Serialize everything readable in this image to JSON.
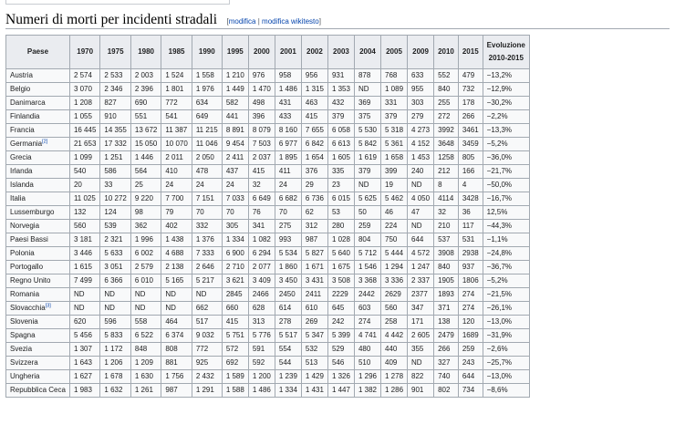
{
  "heading": {
    "title": "Numeri di morti per incidenti stradali",
    "edit_open": "[",
    "edit_link": "modifica",
    "edit_sep": " | ",
    "edit_wiki_link": "modifica wikitesto",
    "edit_close": "]"
  },
  "table": {
    "headers": {
      "country": "Paese",
      "years": [
        "1970",
        "1975",
        "1980",
        "1985",
        "1990",
        "1995",
        "2000",
        "2001",
        "2002",
        "2003",
        "2004",
        "2005",
        "2009",
        "2010",
        "2015"
      ],
      "evolution_line1": "Evoluzione",
      "evolution_line2": "2010-2015"
    },
    "rows": [
      {
        "country": "Austria",
        "ref": "",
        "values": [
          "2 574",
          "2 533",
          "2 003",
          "1 524",
          "1 558",
          "1 210",
          "976",
          "958",
          "956",
          "931",
          "878",
          "768",
          "633",
          "552",
          "479"
        ],
        "change": "−13,2%"
      },
      {
        "country": "Belgio",
        "ref": "",
        "values": [
          "3 070",
          "2 346",
          "2 396",
          "1 801",
          "1 976",
          "1 449",
          "1 470",
          "1 486",
          "1 315",
          "1 353",
          "ND",
          "1 089",
          "955",
          "840",
          "732"
        ],
        "change": "−12,9%"
      },
      {
        "country": "Danimarca",
        "ref": "",
        "values": [
          "1 208",
          "827",
          "690",
          "772",
          "634",
          "582",
          "498",
          "431",
          "463",
          "432",
          "369",
          "331",
          "303",
          "255",
          "178"
        ],
        "change": "−30,2%"
      },
      {
        "country": "Finlandia",
        "ref": "",
        "values": [
          "1 055",
          "910",
          "551",
          "541",
          "649",
          "441",
          "396",
          "433",
          "415",
          "379",
          "375",
          "379",
          "279",
          "272",
          "266"
        ],
        "change": "−2,2%"
      },
      {
        "country": "Francia",
        "ref": "",
        "values": [
          "16 445",
          "14 355",
          "13 672",
          "11 387",
          "11 215",
          "8 891",
          "8 079",
          "8 160",
          "7 655",
          "6 058",
          "5 530",
          "5 318",
          "4 273",
          "3992",
          "3461"
        ],
        "change": "−13,3%"
      },
      {
        "country": "Germania",
        "ref": "[2]",
        "values": [
          "21 653",
          "17 332",
          "15 050",
          "10 070",
          "11 046",
          "9 454",
          "7 503",
          "6 977",
          "6 842",
          "6 613",
          "5 842",
          "5 361",
          "4 152",
          "3648",
          "3459"
        ],
        "change": "−5,2%"
      },
      {
        "country": "Grecia",
        "ref": "",
        "values": [
          "1 099",
          "1 251",
          "1 446",
          "2 011",
          "2 050",
          "2 411",
          "2 037",
          "1 895",
          "1 654",
          "1 605",
          "1 619",
          "1 658",
          "1 453",
          "1258",
          "805"
        ],
        "change": "−36,0%"
      },
      {
        "country": "Irlanda",
        "ref": "",
        "values": [
          "540",
          "586",
          "564",
          "410",
          "478",
          "437",
          "415",
          "411",
          "376",
          "335",
          "379",
          "399",
          "240",
          "212",
          "166"
        ],
        "change": "−21,7%"
      },
      {
        "country": "Islanda",
        "ref": "",
        "values": [
          "20",
          "33",
          "25",
          "24",
          "24",
          "24",
          "32",
          "24",
          "29",
          "23",
          "ND",
          "19",
          "ND",
          "8",
          "4"
        ],
        "change": "−50,0%"
      },
      {
        "country": "Italia",
        "ref": "",
        "values": [
          "11 025",
          "10 272",
          "9 220",
          "7 700",
          "7 151",
          "7 033",
          "6 649",
          "6 682",
          "6 736",
          "6 015",
          "5 625",
          "5 462",
          "4 050",
          "4114",
          "3428"
        ],
        "change": "−16,7%"
      },
      {
        "country": "Lussemburgo",
        "ref": "",
        "values": [
          "132",
          "124",
          "98",
          "79",
          "70",
          "70",
          "76",
          "70",
          "62",
          "53",
          "50",
          "46",
          "47",
          "32",
          "36"
        ],
        "change": "12,5%"
      },
      {
        "country": "Norvegia",
        "ref": "",
        "values": [
          "560",
          "539",
          "362",
          "402",
          "332",
          "305",
          "341",
          "275",
          "312",
          "280",
          "259",
          "224",
          "ND",
          "210",
          "117"
        ],
        "change": "−44,3%"
      },
      {
        "country": "Paesi Bassi",
        "ref": "",
        "values": [
          "3 181",
          "2 321",
          "1 996",
          "1 438",
          "1 376",
          "1 334",
          "1 082",
          "993",
          "987",
          "1 028",
          "804",
          "750",
          "644",
          "537",
          "531"
        ],
        "change": "−1,1%"
      },
      {
        "country": "Polonia",
        "ref": "",
        "values": [
          "3 446",
          "5 633",
          "6 002",
          "4 688",
          "7 333",
          "6 900",
          "6 294",
          "5 534",
          "5 827",
          "5 640",
          "5 712",
          "5 444",
          "4 572",
          "3908",
          "2938"
        ],
        "change": "−24,8%"
      },
      {
        "country": "Portogallo",
        "ref": "",
        "values": [
          "1 615",
          "3 051",
          "2 579",
          "2 138",
          "2 646",
          "2 710",
          "2 077",
          "1 860",
          "1 671",
          "1 675",
          "1 546",
          "1 294",
          "1 247",
          "840",
          "937"
        ],
        "change": "−36,7%"
      },
      {
        "country": "Regno Unito",
        "ref": "",
        "values": [
          "7 499",
          "6 366",
          "6 010",
          "5 165",
          "5 217",
          "3 621",
          "3 409",
          "3 450",
          "3 431",
          "3 508",
          "3 368",
          "3 336",
          "2 337",
          "1905",
          "1806"
        ],
        "change": "−5,2%"
      },
      {
        "country": "Romania",
        "ref": "",
        "values": [
          "ND",
          "ND",
          "ND",
          "ND",
          "ND",
          "2845",
          "2466",
          "2450",
          "2411",
          "2229",
          "2442",
          "2629",
          "2377",
          "1893",
          "274"
        ],
        "change": "−21,5%"
      },
      {
        "country": "Slovacchia",
        "ref": "[3]",
        "values": [
          "ND",
          "ND",
          "ND",
          "ND",
          "662",
          "660",
          "628",
          "614",
          "610",
          "645",
          "603",
          "560",
          "347",
          "371",
          "274"
        ],
        "change": "−26,1%"
      },
      {
        "country": "Slovenia",
        "ref": "",
        "values": [
          "620",
          "596",
          "558",
          "464",
          "517",
          "415",
          "313",
          "278",
          "269",
          "242",
          "274",
          "258",
          "171",
          "138",
          "120"
        ],
        "change": "−13,0%"
      },
      {
        "country": "Spagna",
        "ref": "",
        "values": [
          "5 456",
          "5 833",
          "6 522",
          "6 374",
          "9 032",
          "5 751",
          "5 776",
          "5 517",
          "5 347",
          "5 399",
          "4 741",
          "4 442",
          "2 605",
          "2479",
          "1689"
        ],
        "change": "−31,9%"
      },
      {
        "country": "Svezia",
        "ref": "",
        "values": [
          "1 307",
          "1 172",
          "848",
          "808",
          "772",
          "572",
          "591",
          "554",
          "532",
          "529",
          "480",
          "440",
          "355",
          "266",
          "259"
        ],
        "change": "−2,6%"
      },
      {
        "country": "Svizzera",
        "ref": "",
        "values": [
          "1 643",
          "1 206",
          "1 209",
          "881",
          "925",
          "692",
          "592",
          "544",
          "513",
          "546",
          "510",
          "409",
          "ND",
          "327",
          "243"
        ],
        "change": "−25,7%"
      },
      {
        "country": "Ungheria",
        "ref": "",
        "values": [
          "1 627",
          "1 678",
          "1 630",
          "1 756",
          "2 432",
          "1 589",
          "1 200",
          "1 239",
          "1 429",
          "1 326",
          "1 296",
          "1 278",
          "822",
          "740",
          "644"
        ],
        "change": "−13,0%"
      },
      {
        "country": "Repubblica Ceca",
        "ref": "",
        "values": [
          "1 983",
          "1 632",
          "1 261",
          "987",
          "1 291",
          "1 588",
          "1 486",
          "1 334",
          "1 431",
          "1 447",
          "1 382",
          "1 286",
          "901",
          "802",
          "734"
        ],
        "change": "−8,6%"
      }
    ]
  }
}
